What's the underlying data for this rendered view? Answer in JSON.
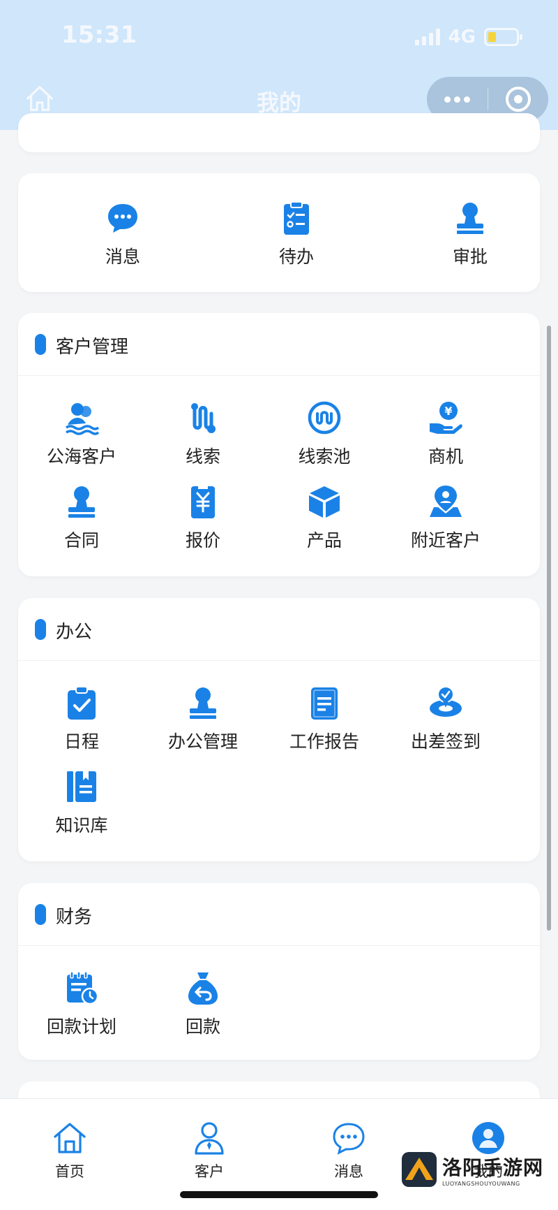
{
  "status_bar": {
    "time": "15:31",
    "network": "4G",
    "battery_level": 0.3
  },
  "nav": {
    "title": "我的"
  },
  "quick_actions": [
    {
      "label": "消息",
      "icon": "chat-bubble-icon"
    },
    {
      "label": "待办",
      "icon": "clipboard-list-icon"
    },
    {
      "label": "审批",
      "icon": "stamp-icon"
    }
  ],
  "sections": {
    "customer": {
      "title": "客户管理",
      "items": [
        {
          "label": "公海客户",
          "icon": "group-wave-icon"
        },
        {
          "label": "线索",
          "icon": "path-icon"
        },
        {
          "label": "线索池",
          "icon": "pool-icon"
        },
        {
          "label": "商机",
          "icon": "money-hand-icon"
        },
        {
          "label": "合同",
          "icon": "stamp-icon"
        },
        {
          "label": "报价",
          "icon": "yuan-tag-icon"
        },
        {
          "label": "产品",
          "icon": "box-icon"
        },
        {
          "label": "附近客户",
          "icon": "map-pin-icon"
        }
      ]
    },
    "office": {
      "title": "办公",
      "items": [
        {
          "label": "日程",
          "icon": "calendar-check-icon"
        },
        {
          "label": "办公管理",
          "icon": "stamp-icon"
        },
        {
          "label": "工作报告",
          "icon": "report-book-icon"
        },
        {
          "label": "出差签到",
          "icon": "location-check-icon"
        },
        {
          "label": "知识库",
          "icon": "books-icon"
        }
      ]
    },
    "finance": {
      "title": "财务",
      "items": [
        {
          "label": "回款计划",
          "icon": "schedule-icon"
        },
        {
          "label": "回款",
          "icon": "money-bag-return-icon"
        }
      ]
    }
  },
  "tabbar": {
    "items": [
      {
        "label": "首页",
        "icon": "home-icon"
      },
      {
        "label": "客户",
        "icon": "person-icon"
      },
      {
        "label": "消息",
        "icon": "chat-bubble-icon"
      },
      {
        "label": "我的",
        "icon": "profile-icon",
        "active": true
      }
    ]
  },
  "watermark": {
    "main": "洛阳手游网",
    "sub": "LUOYANGSHOUYOUWANG"
  },
  "colors": {
    "primary": "#1a82e6",
    "header_bg": "#cfe6fb",
    "page_bg": "#f4f5f7"
  }
}
